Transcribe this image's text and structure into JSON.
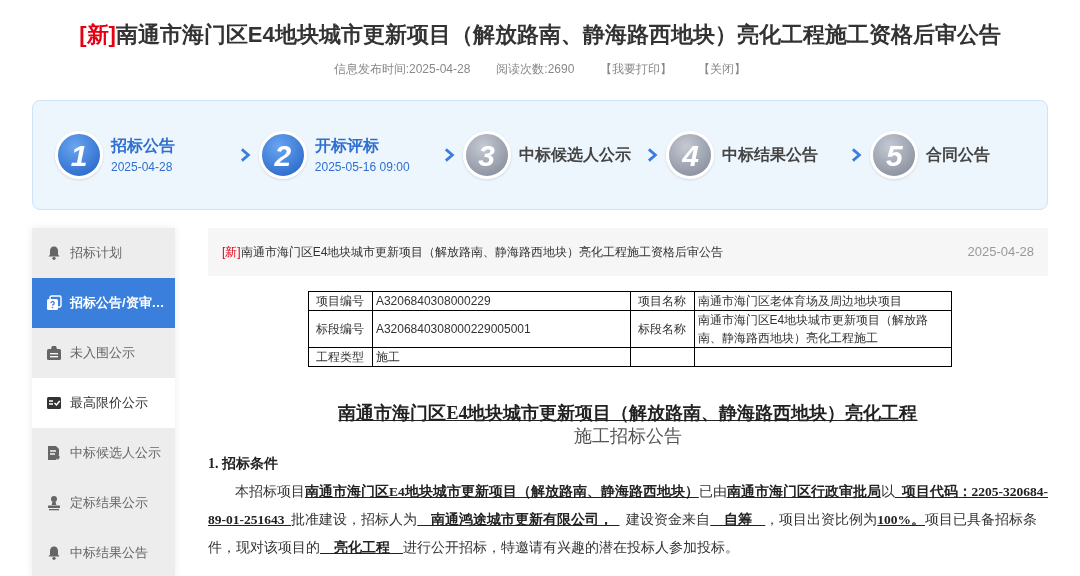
{
  "header": {
    "tag": "[新]",
    "title": "南通市海门区E4地块城市更新项目（解放路南、静海路西地块）亮化工程施工资格后审公告",
    "meta": [
      "信息发布时间:2025-04-28",
      "阅读次数:2690"
    ],
    "links": [
      "【我要打印】",
      "【关闭】"
    ]
  },
  "steps": [
    {
      "number": "1",
      "title": "招标公告",
      "date": "2025-04-28",
      "done": true
    },
    {
      "number": "2",
      "title": "开标评标",
      "date": "2025-05-16 09:00",
      "done": true
    },
    {
      "number": "3",
      "title": "中标候选人公示",
      "done": false
    },
    {
      "number": "4",
      "title": "中标结果公告",
      "done": false
    },
    {
      "number": "5",
      "title": "合同公告",
      "done": false
    }
  ],
  "sidebar": {
    "items": [
      {
        "label": "招标计划",
        "kind": "bell",
        "selected": false,
        "hovered": false
      },
      {
        "label": "招标公告/资审…",
        "kind": "question",
        "selected": true,
        "hovered": false
      },
      {
        "label": "未入围公示",
        "kind": "briefcase",
        "selected": false,
        "hovered": false
      },
      {
        "label": "最高限价公示",
        "kind": "check",
        "selected": false,
        "hovered": true
      },
      {
        "label": "中标候选人公示",
        "kind": "doc",
        "selected": false,
        "hovered": false
      },
      {
        "label": "定标结果公示",
        "kind": "stamp",
        "selected": false,
        "hovered": false
      },
      {
        "label": "中标结果公告",
        "kind": "bell",
        "selected": false,
        "hovered": false
      }
    ]
  },
  "notice_bar": {
    "tag": "[新]",
    "title": "南通市海门区E4地块城市更新项目（解放路南、静海路西地块）亮化工程施工资格后审公告",
    "date": "2025-04-28"
  },
  "info_table": {
    "rows": [
      [
        "项目编号",
        "A3206840308000229",
        "项目名称",
        "南通市海门区老体育场及周边地块项目"
      ],
      [
        "标段编号",
        "A3206840308000229005001",
        "标段名称",
        "南通市海门区E4地块城市更新项目（解放路南、静海路西地块）亮化工程施工"
      ],
      [
        "工程类型",
        "施工",
        "",
        ""
      ]
    ]
  },
  "document": {
    "title": "南通市海门区E4地块城市更新项目（解放路南、静海路西地块）亮化工程",
    "subtitle": "施工招标公告",
    "section": "1. 招标条件",
    "paragraph": [
      {
        "text": "本招标项目",
        "kind": "plain"
      },
      {
        "text": "南通市海门区E4地块城市更新项目（解放路南、静海路西地块）",
        "kind": "filled"
      },
      {
        "text": "已由",
        "kind": "plain"
      },
      {
        "text": "南通市海门区行政审批局",
        "kind": "filled"
      },
      {
        "text": "以",
        "kind": "plain"
      },
      {
        "text": "  项目代码：2205-320684-89-01-251643  ",
        "kind": "filled"
      },
      {
        "text": "批准建设，招标人为",
        "kind": "plain"
      },
      {
        "text": "    南通鸿途城市更新有限公司，  ",
        "kind": "filled"
      },
      {
        "text": "  建设资金来自",
        "kind": "plain"
      },
      {
        "text": "    自筹    ",
        "kind": "filled"
      },
      {
        "text": "，项目出资比例为",
        "kind": "plain"
      },
      {
        "text": "100%。",
        "kind": "filled"
      },
      {
        "text": "项目已具备招标条件，现对该项目的",
        "kind": "plain"
      },
      {
        "text": "    亮化工程    ",
        "kind": "filled"
      },
      {
        "text": "进行公开招标，特邀请有兴趣的潜在投标人参加投标。",
        "kind": "plain"
      }
    ]
  }
}
